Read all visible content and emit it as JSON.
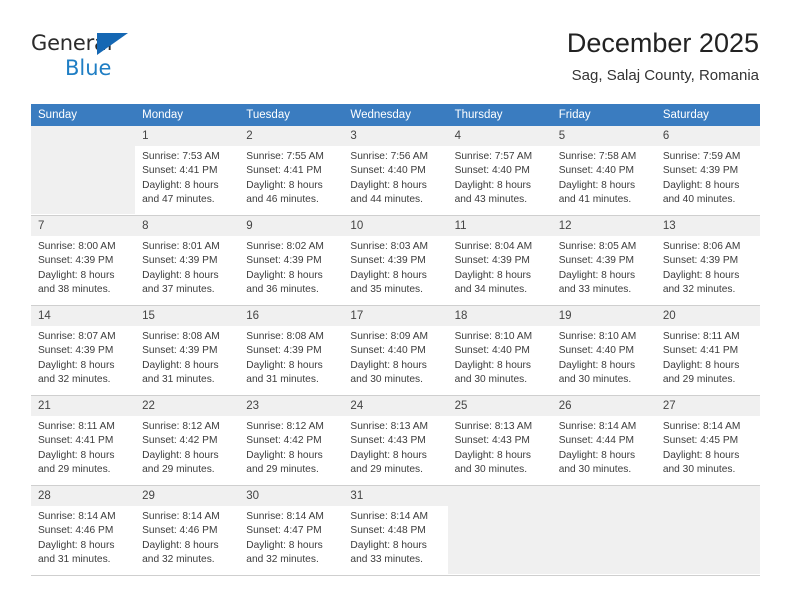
{
  "brand": {
    "name_part1": "General",
    "name_part2": "Blue",
    "accent_color": "#1f7ec4",
    "triangle_color": "#1567b3"
  },
  "header": {
    "title": "December 2025",
    "subtitle": "Sag, Salaj County, Romania"
  },
  "calendar": {
    "header_bg": "#3a7cc0",
    "weekdays": [
      "Sunday",
      "Monday",
      "Tuesday",
      "Wednesday",
      "Thursday",
      "Friday",
      "Saturday"
    ],
    "weeks": [
      [
        {
          "day": "",
          "lines": []
        },
        {
          "day": "1",
          "lines": [
            "Sunrise: 7:53 AM",
            "Sunset: 4:41 PM",
            "Daylight: 8 hours",
            "and 47 minutes."
          ]
        },
        {
          "day": "2",
          "lines": [
            "Sunrise: 7:55 AM",
            "Sunset: 4:41 PM",
            "Daylight: 8 hours",
            "and 46 minutes."
          ]
        },
        {
          "day": "3",
          "lines": [
            "Sunrise: 7:56 AM",
            "Sunset: 4:40 PM",
            "Daylight: 8 hours",
            "and 44 minutes."
          ]
        },
        {
          "day": "4",
          "lines": [
            "Sunrise: 7:57 AM",
            "Sunset: 4:40 PM",
            "Daylight: 8 hours",
            "and 43 minutes."
          ]
        },
        {
          "day": "5",
          "lines": [
            "Sunrise: 7:58 AM",
            "Sunset: 4:40 PM",
            "Daylight: 8 hours",
            "and 41 minutes."
          ]
        },
        {
          "day": "6",
          "lines": [
            "Sunrise: 7:59 AM",
            "Sunset: 4:39 PM",
            "Daylight: 8 hours",
            "and 40 minutes."
          ]
        }
      ],
      [
        {
          "day": "7",
          "lines": [
            "Sunrise: 8:00 AM",
            "Sunset: 4:39 PM",
            "Daylight: 8 hours",
            "and 38 minutes."
          ]
        },
        {
          "day": "8",
          "lines": [
            "Sunrise: 8:01 AM",
            "Sunset: 4:39 PM",
            "Daylight: 8 hours",
            "and 37 minutes."
          ]
        },
        {
          "day": "9",
          "lines": [
            "Sunrise: 8:02 AM",
            "Sunset: 4:39 PM",
            "Daylight: 8 hours",
            "and 36 minutes."
          ]
        },
        {
          "day": "10",
          "lines": [
            "Sunrise: 8:03 AM",
            "Sunset: 4:39 PM",
            "Daylight: 8 hours",
            "and 35 minutes."
          ]
        },
        {
          "day": "11",
          "lines": [
            "Sunrise: 8:04 AM",
            "Sunset: 4:39 PM",
            "Daylight: 8 hours",
            "and 34 minutes."
          ]
        },
        {
          "day": "12",
          "lines": [
            "Sunrise: 8:05 AM",
            "Sunset: 4:39 PM",
            "Daylight: 8 hours",
            "and 33 minutes."
          ]
        },
        {
          "day": "13",
          "lines": [
            "Sunrise: 8:06 AM",
            "Sunset: 4:39 PM",
            "Daylight: 8 hours",
            "and 32 minutes."
          ]
        }
      ],
      [
        {
          "day": "14",
          "lines": [
            "Sunrise: 8:07 AM",
            "Sunset: 4:39 PM",
            "Daylight: 8 hours",
            "and 32 minutes."
          ]
        },
        {
          "day": "15",
          "lines": [
            "Sunrise: 8:08 AM",
            "Sunset: 4:39 PM",
            "Daylight: 8 hours",
            "and 31 minutes."
          ]
        },
        {
          "day": "16",
          "lines": [
            "Sunrise: 8:08 AM",
            "Sunset: 4:39 PM",
            "Daylight: 8 hours",
            "and 31 minutes."
          ]
        },
        {
          "day": "17",
          "lines": [
            "Sunrise: 8:09 AM",
            "Sunset: 4:40 PM",
            "Daylight: 8 hours",
            "and 30 minutes."
          ]
        },
        {
          "day": "18",
          "lines": [
            "Sunrise: 8:10 AM",
            "Sunset: 4:40 PM",
            "Daylight: 8 hours",
            "and 30 minutes."
          ]
        },
        {
          "day": "19",
          "lines": [
            "Sunrise: 8:10 AM",
            "Sunset: 4:40 PM",
            "Daylight: 8 hours",
            "and 30 minutes."
          ]
        },
        {
          "day": "20",
          "lines": [
            "Sunrise: 8:11 AM",
            "Sunset: 4:41 PM",
            "Daylight: 8 hours",
            "and 29 minutes."
          ]
        }
      ],
      [
        {
          "day": "21",
          "lines": [
            "Sunrise: 8:11 AM",
            "Sunset: 4:41 PM",
            "Daylight: 8 hours",
            "and 29 minutes."
          ]
        },
        {
          "day": "22",
          "lines": [
            "Sunrise: 8:12 AM",
            "Sunset: 4:42 PM",
            "Daylight: 8 hours",
            "and 29 minutes."
          ]
        },
        {
          "day": "23",
          "lines": [
            "Sunrise: 8:12 AM",
            "Sunset: 4:42 PM",
            "Daylight: 8 hours",
            "and 29 minutes."
          ]
        },
        {
          "day": "24",
          "lines": [
            "Sunrise: 8:13 AM",
            "Sunset: 4:43 PM",
            "Daylight: 8 hours",
            "and 29 minutes."
          ]
        },
        {
          "day": "25",
          "lines": [
            "Sunrise: 8:13 AM",
            "Sunset: 4:43 PM",
            "Daylight: 8 hours",
            "and 30 minutes."
          ]
        },
        {
          "day": "26",
          "lines": [
            "Sunrise: 8:14 AM",
            "Sunset: 4:44 PM",
            "Daylight: 8 hours",
            "and 30 minutes."
          ]
        },
        {
          "day": "27",
          "lines": [
            "Sunrise: 8:14 AM",
            "Sunset: 4:45 PM",
            "Daylight: 8 hours",
            "and 30 minutes."
          ]
        }
      ],
      [
        {
          "day": "28",
          "lines": [
            "Sunrise: 8:14 AM",
            "Sunset: 4:46 PM",
            "Daylight: 8 hours",
            "and 31 minutes."
          ]
        },
        {
          "day": "29",
          "lines": [
            "Sunrise: 8:14 AM",
            "Sunset: 4:46 PM",
            "Daylight: 8 hours",
            "and 32 minutes."
          ]
        },
        {
          "day": "30",
          "lines": [
            "Sunrise: 8:14 AM",
            "Sunset: 4:47 PM",
            "Daylight: 8 hours",
            "and 32 minutes."
          ]
        },
        {
          "day": "31",
          "lines": [
            "Sunrise: 8:14 AM",
            "Sunset: 4:48 PM",
            "Daylight: 8 hours",
            "and 33 minutes."
          ]
        },
        {
          "day": "",
          "lines": []
        },
        {
          "day": "",
          "lines": []
        },
        {
          "day": "",
          "lines": []
        }
      ]
    ]
  }
}
